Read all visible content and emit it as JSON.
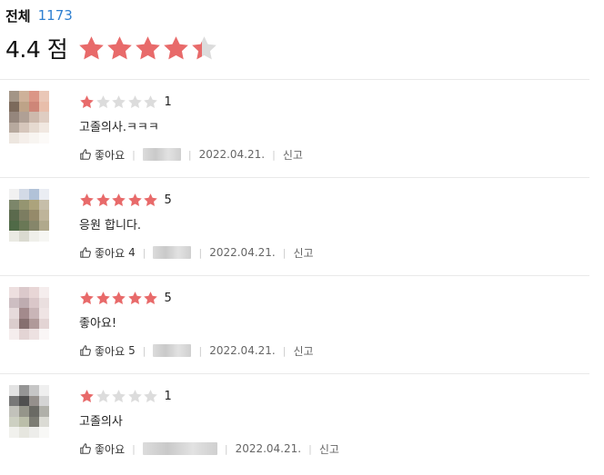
{
  "summary": {
    "total_label": "전체",
    "total_count": "1173",
    "average_score": "4.4 점",
    "average_rating": 4.4,
    "max_rating": 5
  },
  "colors": {
    "star_filled": "#e86a6a",
    "star_empty": "#dcdcdc",
    "count_blue": "#2f80d1"
  },
  "reviews": [
    {
      "rating": 1,
      "score_text": "1",
      "comment": "고졸의사.ㅋㅋㅋ",
      "like_label": "좋아요",
      "like_count": "",
      "date": "2022.04.21.",
      "report_label": "신고",
      "avatar_colors": [
        "#9a8a7a",
        "#c9a98f",
        "#d88b7a",
        "#e8c2b0",
        "#6e5a4a",
        "#b89a7c",
        "#c97a6a",
        "#e6b8a2",
        "#8a7a6e",
        "#a8968a",
        "#c8b2a4",
        "#dcc8bc",
        "#b0a094",
        "#d2c0b4",
        "#e4d6cc",
        "#f0e6de",
        "#ece4dc",
        "#f4eee8",
        "#f8f4f0",
        "#fcfaf8"
      ]
    },
    {
      "rating": 5,
      "score_text": "5",
      "comment": "응원 합니다.",
      "like_label": "좋아요",
      "like_count": "4",
      "date": "2022.04.21.",
      "report_label": "신고",
      "avatar_colors": [
        "#f0f0f0",
        "#cfd6e4",
        "#a9bcd4",
        "#e8ecf2",
        "#6e7a5a",
        "#8a8a62",
        "#a49a6e",
        "#c0b8a0",
        "#4a5a3a",
        "#6e7050",
        "#8a7e5a",
        "#b8ac90",
        "#3e5a34",
        "#5a6a44",
        "#7a7a5a",
        "#a8a080",
        "#e8e8e0",
        "#d6d6cc",
        "#eeeee8",
        "#f6f6f2"
      ]
    },
    {
      "rating": 5,
      "score_text": "5",
      "comment": "좋아요!",
      "like_label": "좋아요",
      "like_count": "5",
      "date": "2022.04.21.",
      "report_label": "신고",
      "avatar_colors": [
        "#ecdcdc",
        "#d8c4c6",
        "#e6d2d2",
        "#f4ecec",
        "#c8b8bc",
        "#b8a4a8",
        "#d6c2c4",
        "#e8dcdc",
        "#e4d6d8",
        "#9a7e80",
        "#c4aeb0",
        "#eee2e2",
        "#d8c8c8",
        "#7a6060",
        "#a88e8e",
        "#e0d0d0",
        "#f4ecec",
        "#e0d0d0",
        "#ecdede",
        "#faf6f6"
      ]
    },
    {
      "rating": 1,
      "score_text": "1",
      "comment": "고졸의사",
      "like_label": "좋아요",
      "like_count": "",
      "date": "2022.04.21.",
      "report_label": "신고",
      "avatar_colors": [
        "#e0e0e0",
        "#8a8a8a",
        "#c0c0c0",
        "#eeeeee",
        "#6a6a6a",
        "#3e3e3e",
        "#8a8480",
        "#d0d0d0",
        "#bcbcb4",
        "#8a8a7e",
        "#5a5a54",
        "#a8a8a0",
        "#c8ccbc",
        "#b4b8a0",
        "#6e6e64",
        "#d8d8d0",
        "#f0f0ec",
        "#e4e4dc",
        "#ecece8",
        "#f8f8f6"
      ]
    }
  ]
}
